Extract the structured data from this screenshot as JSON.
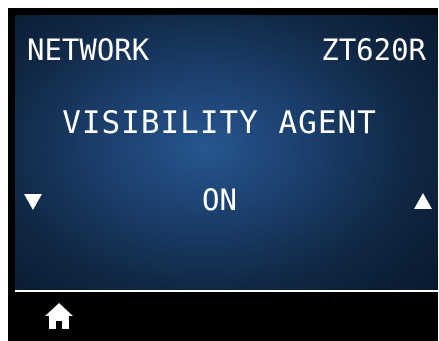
{
  "header": {
    "menu_title": "NETWORK",
    "model": "ZT620R"
  },
  "setting": {
    "name": "VISIBILITY AGENT",
    "value": "ON"
  },
  "icons": {
    "left": "down-arrow-icon",
    "right": "up-arrow-icon",
    "home": "home-icon"
  },
  "colors": {
    "text": "#ffffff",
    "panel_center": "#26568f",
    "panel_edge": "#0a1a30",
    "bezel": "#000000"
  }
}
